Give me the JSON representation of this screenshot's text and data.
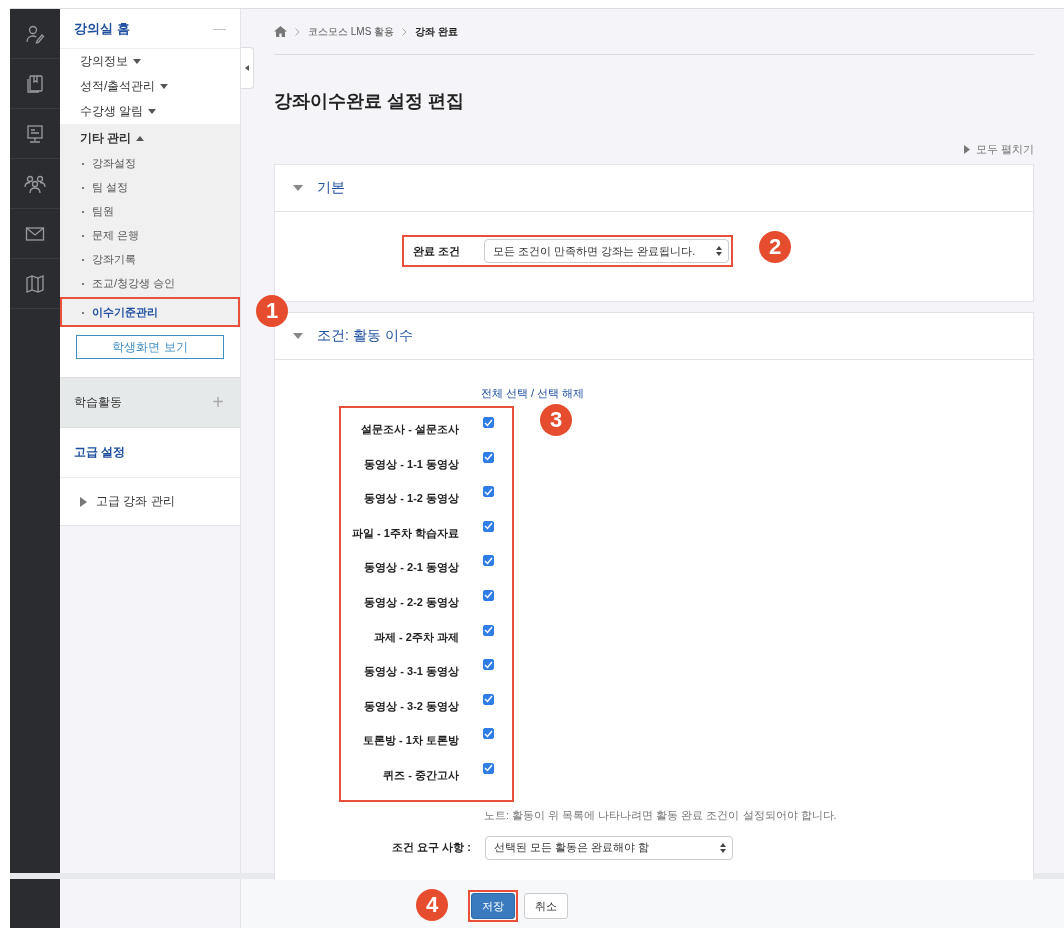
{
  "sidebar": {
    "title": "강의실 홈",
    "collapse_icon": "—",
    "menu": [
      {
        "label": "강의정보",
        "expanded": false
      },
      {
        "label": "성적/출석관리",
        "expanded": false
      },
      {
        "label": "수강생 알림",
        "expanded": false
      },
      {
        "label": "기타 관리",
        "expanded": true,
        "children": [
          {
            "label": "강좌설정",
            "selected": false
          },
          {
            "label": "팀 설정",
            "selected": false
          },
          {
            "label": "팀원",
            "selected": false
          },
          {
            "label": "문제 은행",
            "selected": false
          },
          {
            "label": "강좌기록",
            "selected": false
          },
          {
            "label": "조교/청강생 승인",
            "selected": false
          },
          {
            "label": "이수기준관리",
            "selected": true
          }
        ]
      }
    ],
    "view_button": "학생화면 보기",
    "activity_section": {
      "label": "학습활동",
      "add_icon": "+"
    },
    "advanced_section": {
      "title": "고급 설정",
      "items": [
        {
          "label": "고급 강좌 관리",
          "expanded": false
        }
      ]
    }
  },
  "breadcrumb": [
    "코스모스 LMS 활용",
    "강좌 완료"
  ],
  "page_title": "강좌이수완료 설정 편집",
  "expand_all": "모두 펼치기",
  "sections": [
    {
      "title": "기본",
      "expanded": true
    },
    {
      "title": "조건: 활동 이수",
      "expanded": true
    }
  ],
  "basic": {
    "label": "완료 조건",
    "value": "모든 조건이 만족하면 강좌는 완료됩니다."
  },
  "activity": {
    "select_all": "전체 선택 / 선택 해제",
    "items": [
      {
        "label": "설문조사 - 설문조사",
        "checked": true
      },
      {
        "label": "동영상 - 1-1 동영상",
        "checked": true
      },
      {
        "label": "동영상 - 1-2 동영상",
        "checked": true
      },
      {
        "label": "파일 - 1주차 학습자료",
        "checked": true
      },
      {
        "label": "동영상 - 2-1 동영상",
        "checked": true
      },
      {
        "label": "동영상 - 2-2 동영상",
        "checked": true
      },
      {
        "label": "과제 - 2주차 과제",
        "checked": true
      },
      {
        "label": "동영상 - 3-1 동영상",
        "checked": true
      },
      {
        "label": "동영상 - 3-2 동영상",
        "checked": true
      },
      {
        "label": "토론방 - 1차 토론방",
        "checked": true
      },
      {
        "label": "퀴즈 - 중간고사",
        "checked": true
      }
    ],
    "note": "노트: 활동이 위 목록에 나타나려면 활동 완료 조건이 설정되어야 합니다.",
    "requirement": {
      "label": "조건 요구 사항 :",
      "value": "선택된 모든 활동은 완료해야 함"
    }
  },
  "buttons": [
    {
      "label": "저장",
      "kind": "primary"
    },
    {
      "label": "취소",
      "kind": "secondary"
    }
  ],
  "callouts": [
    "1",
    "2",
    "3",
    "4"
  ]
}
